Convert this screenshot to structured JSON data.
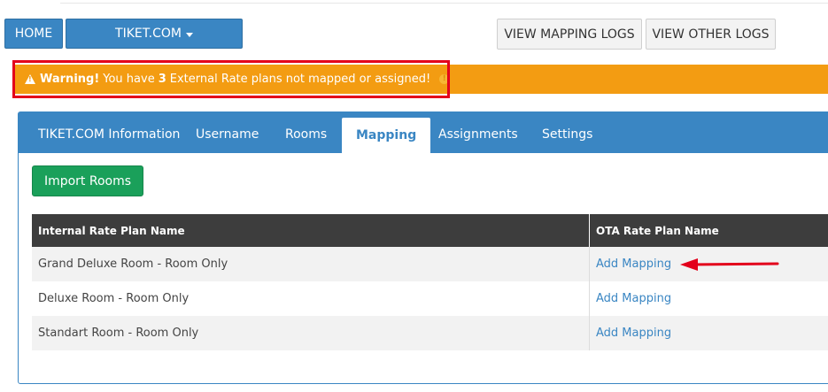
{
  "nav": {
    "home_label": "HOME",
    "ota_label": "TIKET.COM",
    "mapping_logs_label": "VIEW MAPPING LOGS",
    "other_logs_label": "VIEW OTHER LOGS"
  },
  "warning": {
    "prefix": "Warning!",
    "text_before": "You have",
    "count": "3",
    "text_after": "External Rate plans not mapped or assigned!"
  },
  "tabs": [
    {
      "label": "TIKET.COM Information",
      "active": false
    },
    {
      "label": "Username",
      "active": false
    },
    {
      "label": "Rooms",
      "active": false
    },
    {
      "label": "Mapping",
      "active": true
    },
    {
      "label": "Assignments",
      "active": false
    },
    {
      "label": "Settings",
      "active": false
    }
  ],
  "import_button_label": "Import Rooms",
  "table": {
    "headers": [
      "Internal Rate Plan Name",
      "OTA Rate Plan Name"
    ],
    "rows": [
      {
        "internal": "Grand Deluxe Room - Room Only",
        "ota_link": "Add Mapping"
      },
      {
        "internal": "Deluxe Room - Room Only",
        "ota_link": "Add Mapping"
      },
      {
        "internal": "Standart Room - Room Only",
        "ota_link": "Add Mapping"
      }
    ]
  },
  "colors": {
    "primary": "#3a86c3",
    "warning": "#f39c12",
    "success": "#1aa05a",
    "annotation": "#e3001b"
  }
}
